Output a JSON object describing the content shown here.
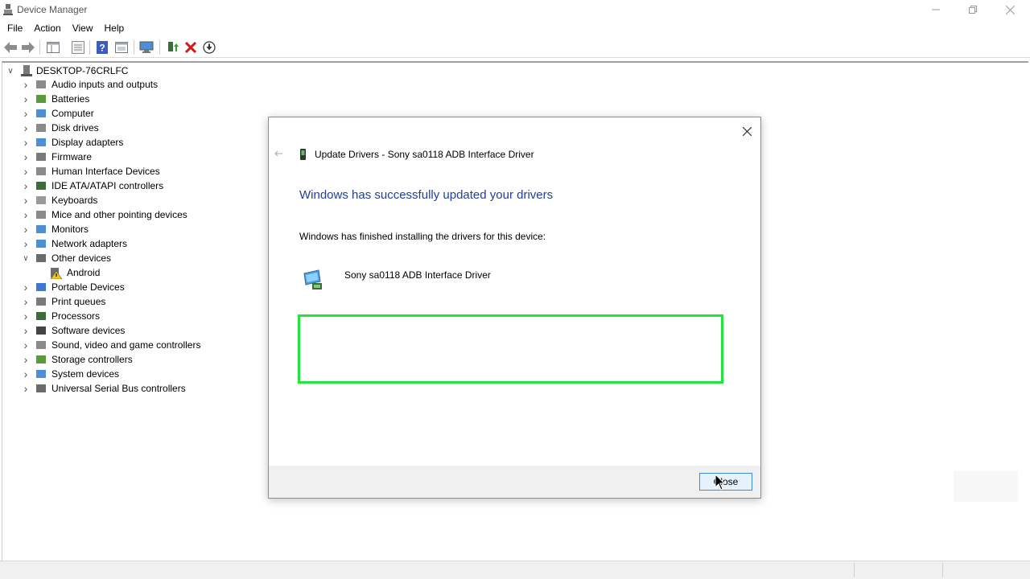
{
  "window": {
    "title": "Device Manager",
    "controls": [
      "minimize",
      "restore",
      "close"
    ]
  },
  "menu": {
    "items": [
      "File",
      "Action",
      "View",
      "Help"
    ]
  },
  "toolbar": {
    "icons": [
      "back-arrow-icon",
      "forward-arrow-icon",
      "properties-pane-icon",
      "device-list-icon",
      "help-icon",
      "view-resources-icon",
      "monitor-scan-icon",
      "update-driver-icon",
      "uninstall-x-icon",
      "download-circle-icon"
    ]
  },
  "tree": {
    "root": "DESKTOP-76CRLFC",
    "categories": [
      {
        "label": "Audio inputs and outputs",
        "icon": "speaker-icon"
      },
      {
        "label": "Batteries",
        "icon": "battery-icon"
      },
      {
        "label": "Computer",
        "icon": "computer-icon"
      },
      {
        "label": "Disk drives",
        "icon": "disk-icon"
      },
      {
        "label": "Display adapters",
        "icon": "display-adapter-icon"
      },
      {
        "label": "Firmware",
        "icon": "firmware-icon"
      },
      {
        "label": "Human Interface Devices",
        "icon": "hid-icon"
      },
      {
        "label": "IDE ATA/ATAPI controllers",
        "icon": "ide-icon"
      },
      {
        "label": "Keyboards",
        "icon": "keyboard-icon"
      },
      {
        "label": "Mice and other pointing devices",
        "icon": "mouse-icon"
      },
      {
        "label": "Monitors",
        "icon": "monitor-icon"
      },
      {
        "label": "Network adapters",
        "icon": "network-icon"
      },
      {
        "label": "Other devices",
        "icon": "unknown-device-icon",
        "expanded": true
      },
      {
        "label": "Portable Devices",
        "icon": "portable-device-icon"
      },
      {
        "label": "Print queues",
        "icon": "printer-icon"
      },
      {
        "label": "Processors",
        "icon": "processor-icon"
      },
      {
        "label": "Software devices",
        "icon": "software-device-icon"
      },
      {
        "label": "Sound, video and game controllers",
        "icon": "sound-icon"
      },
      {
        "label": "Storage controllers",
        "icon": "storage-icon"
      },
      {
        "label": "System devices",
        "icon": "system-icon"
      },
      {
        "label": "Universal Serial Bus controllers",
        "icon": "usb-icon"
      }
    ],
    "child_android": "Android"
  },
  "dialog": {
    "header": "Update Drivers - Sony sa0118 ADB Interface Driver",
    "heading": "Windows has successfully updated your drivers",
    "message": "Windows has finished installing the drivers for this device:",
    "device_name": "Sony sa0118 ADB Interface Driver",
    "close_button": "Close"
  },
  "colors": {
    "heading": "#1f3f9a",
    "highlight": "#22e43a",
    "button_bg": "#e5f1fb",
    "button_border": "#3c8cd8"
  }
}
